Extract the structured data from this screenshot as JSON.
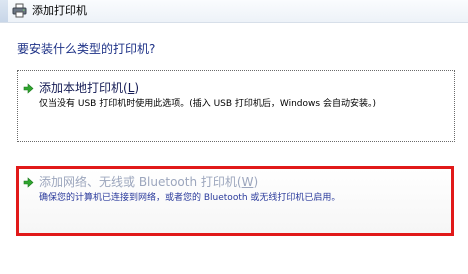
{
  "titlebar": {
    "title": "添加打印机",
    "icon": "printer-icon"
  },
  "main": {
    "heading": "要安装什么类型的打印机?"
  },
  "options": [
    {
      "title": "添加本地打印机(",
      "accel": "L",
      "title_end": ")",
      "description": "仅当没有 USB 打印机时使用此选项。(插入 USB 打印机后，Windows 会自动安装。)",
      "icon": "green-arrow-icon"
    },
    {
      "title": "添加网络、无线或 Bluetooth 打印机(",
      "accel": "W",
      "title_end": ")",
      "description": "确保您的计算机已连接到网络，或者您的 Bluetooth 或无线打印机已启用。",
      "icon": "green-arrow-icon"
    }
  ],
  "colors": {
    "heading": "#1e3287",
    "highlight_border": "#e11919",
    "arrow": "#2fa52f"
  }
}
